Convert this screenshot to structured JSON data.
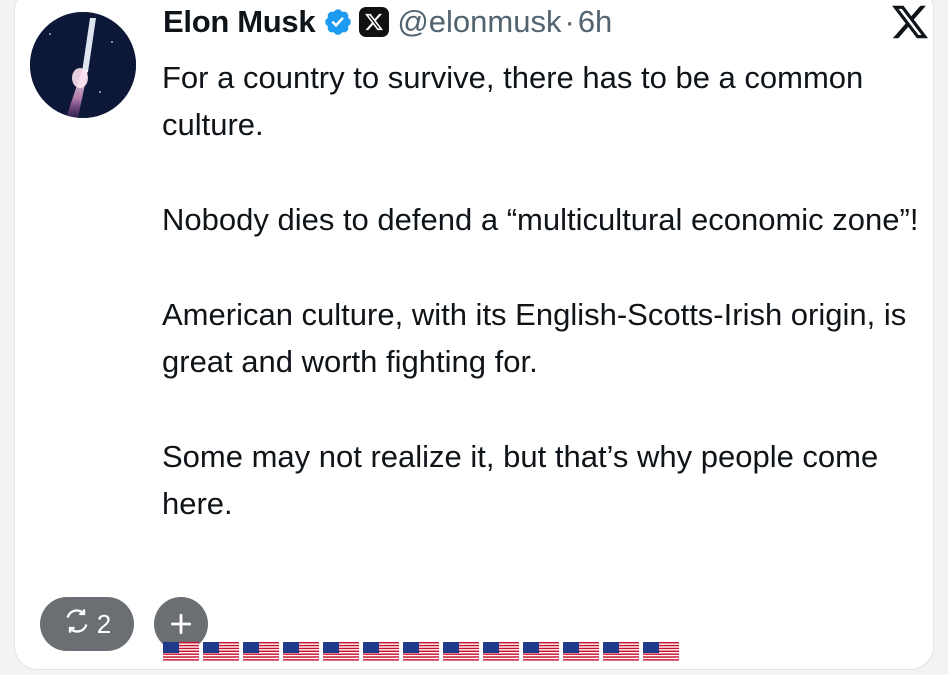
{
  "author": {
    "name": "Elon Musk",
    "handle": "@elonmusk",
    "separator": "·",
    "time": "6h"
  },
  "tweet": {
    "paragraphs": [
      "For a country to survive, there has to be a common culture.",
      "Nobody dies to defend a “multicultural economic zone”!",
      "American culture, with its English-Scotts-Irish origin, is great and worth fighting for.",
      "Some may not realize it, but that’s why people come here."
    ]
  },
  "reactions": {
    "retweet_count": "2",
    "add_label": "+",
    "flag_count": 13
  },
  "icons": {
    "verified": "verified-badge-icon",
    "x_badge": "x-affiliate-icon",
    "x_logo": "x-logo-icon",
    "retweet": "retweet-icon",
    "add": "plus-icon",
    "flag": "us-flag-emoji"
  },
  "colors": {
    "verified_blue": "#1d9bf0",
    "text": "#0f1419",
    "muted": "#536471",
    "pill": "#6b6f73"
  }
}
